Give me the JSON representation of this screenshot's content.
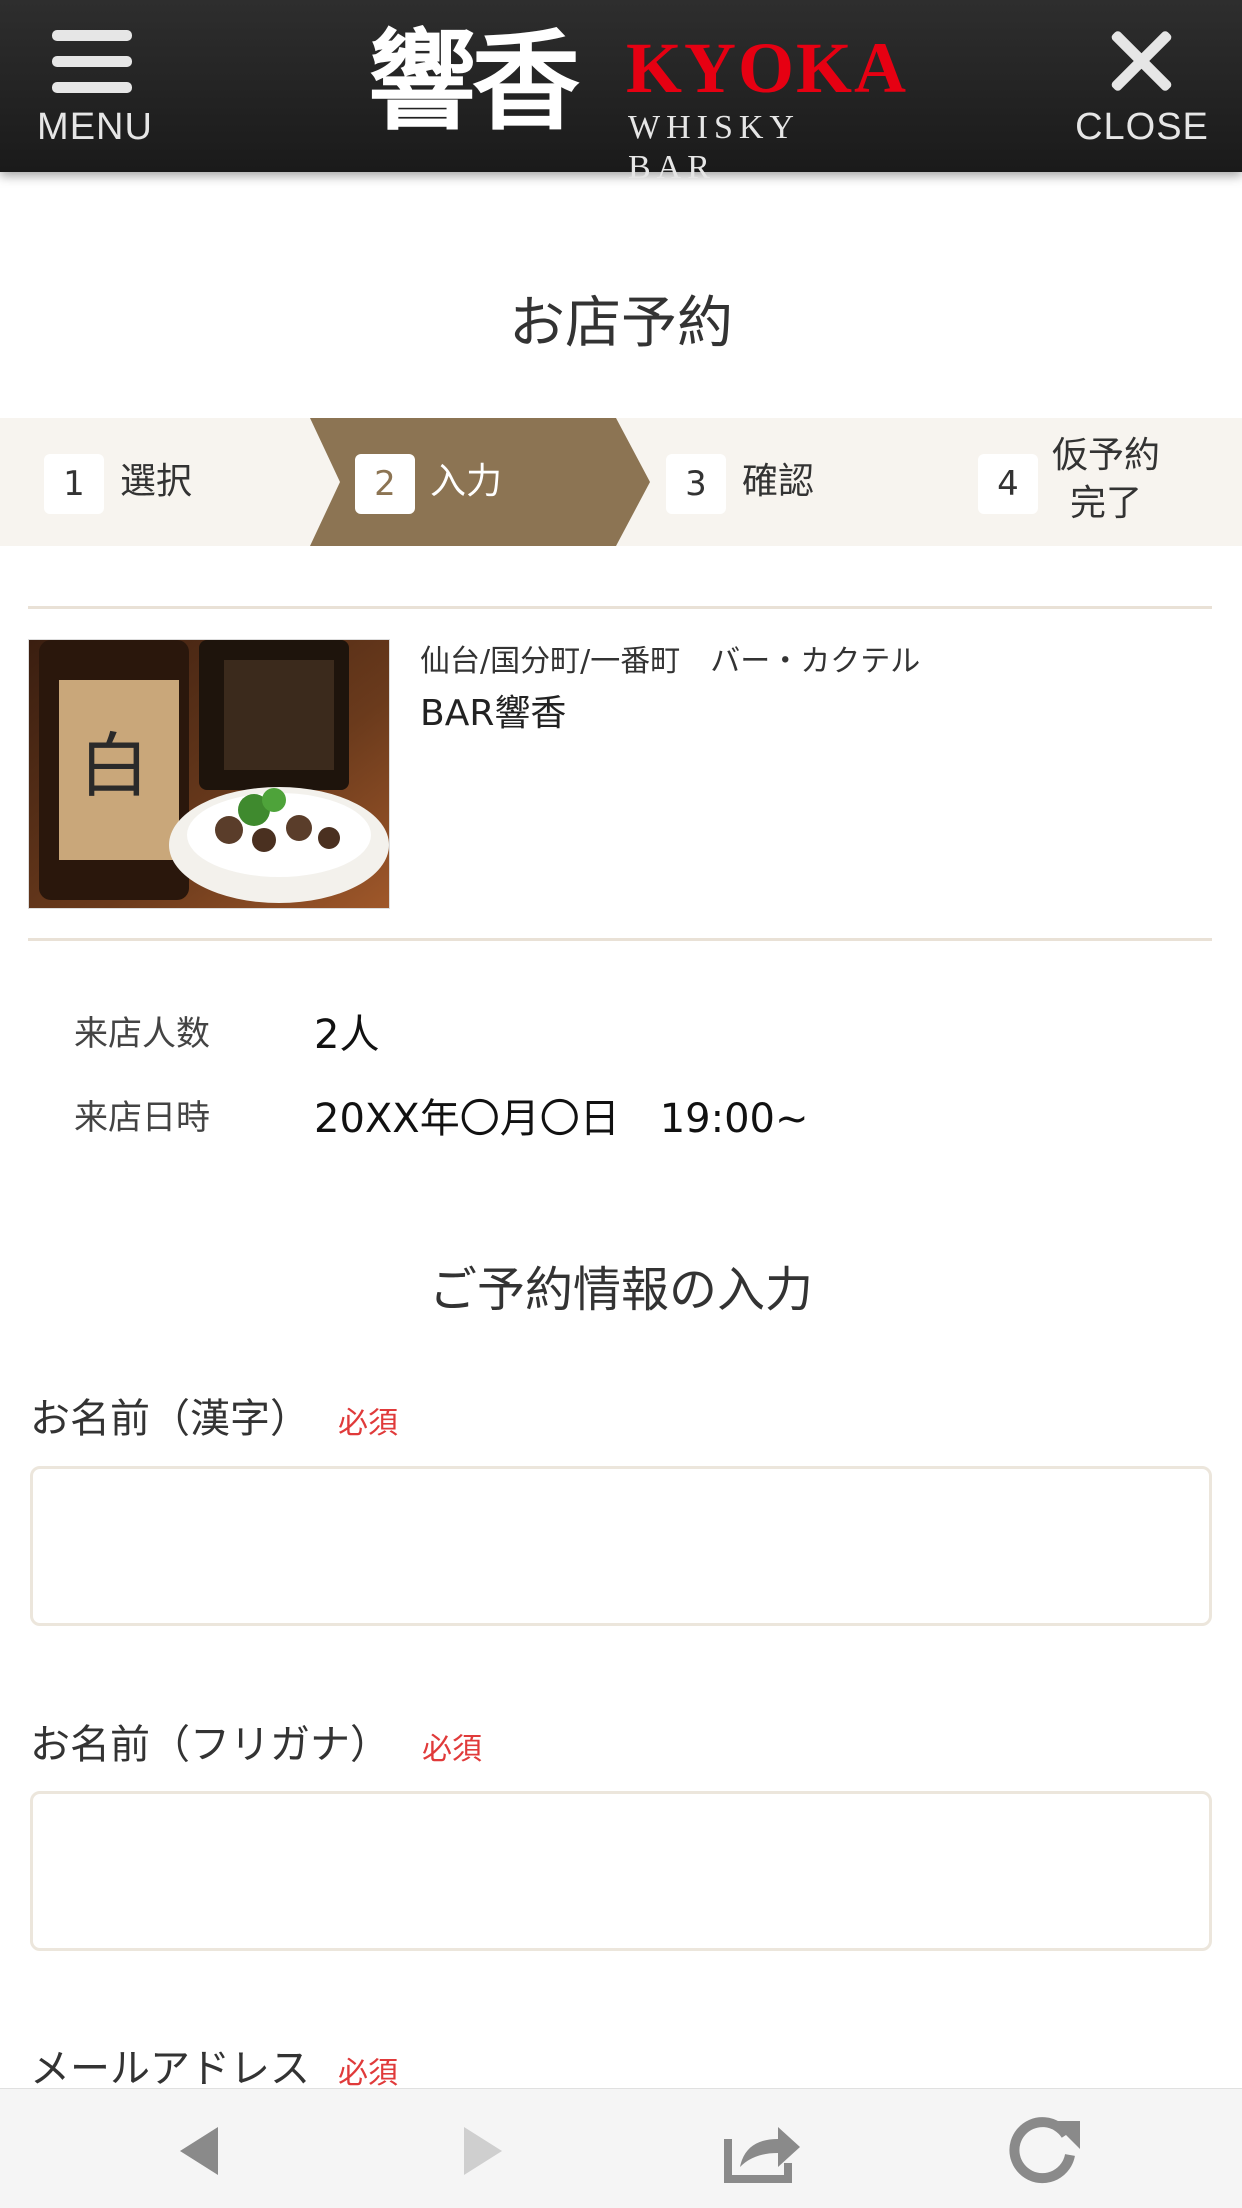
{
  "header": {
    "menu_label": "MENU",
    "close_label": "CLOSE",
    "logo_kanji": "響香",
    "logo_name": "KYOKA",
    "logo_sub": "WHISKY BAR"
  },
  "page_title": "お店予約",
  "steps": [
    {
      "num": "1",
      "label": "選択",
      "active": false
    },
    {
      "num": "2",
      "label": "入力",
      "active": true
    },
    {
      "num": "3",
      "label": "確認",
      "active": false
    },
    {
      "num": "4",
      "label_line1": "仮予約",
      "label_line2": "完了",
      "active": false
    }
  ],
  "shop": {
    "category": "仙台/国分町/一番町　バー・カクテル",
    "name": "BAR響香"
  },
  "reservation": {
    "people_label": "来店人数",
    "people_value": "2人",
    "datetime_label": "来店日時",
    "datetime_value": "20XX年〇月〇日　19:00~"
  },
  "form": {
    "section_title": "ご予約情報の入力",
    "required_label": "必須",
    "name_kanji_label": "お名前（漢字）",
    "name_kana_label": "お名前（フリガナ）",
    "email_label": "メールアドレス"
  },
  "colors": {
    "header_bg": "#1f1f1f",
    "brand_red": "#e60012",
    "step_active": "#8c7453",
    "step_bar_bg": "#f7f4ef",
    "required": "#e03a3a"
  },
  "browser_bar": {
    "icons": [
      "back-icon",
      "forward-icon",
      "share-icon",
      "reload-icon"
    ]
  }
}
